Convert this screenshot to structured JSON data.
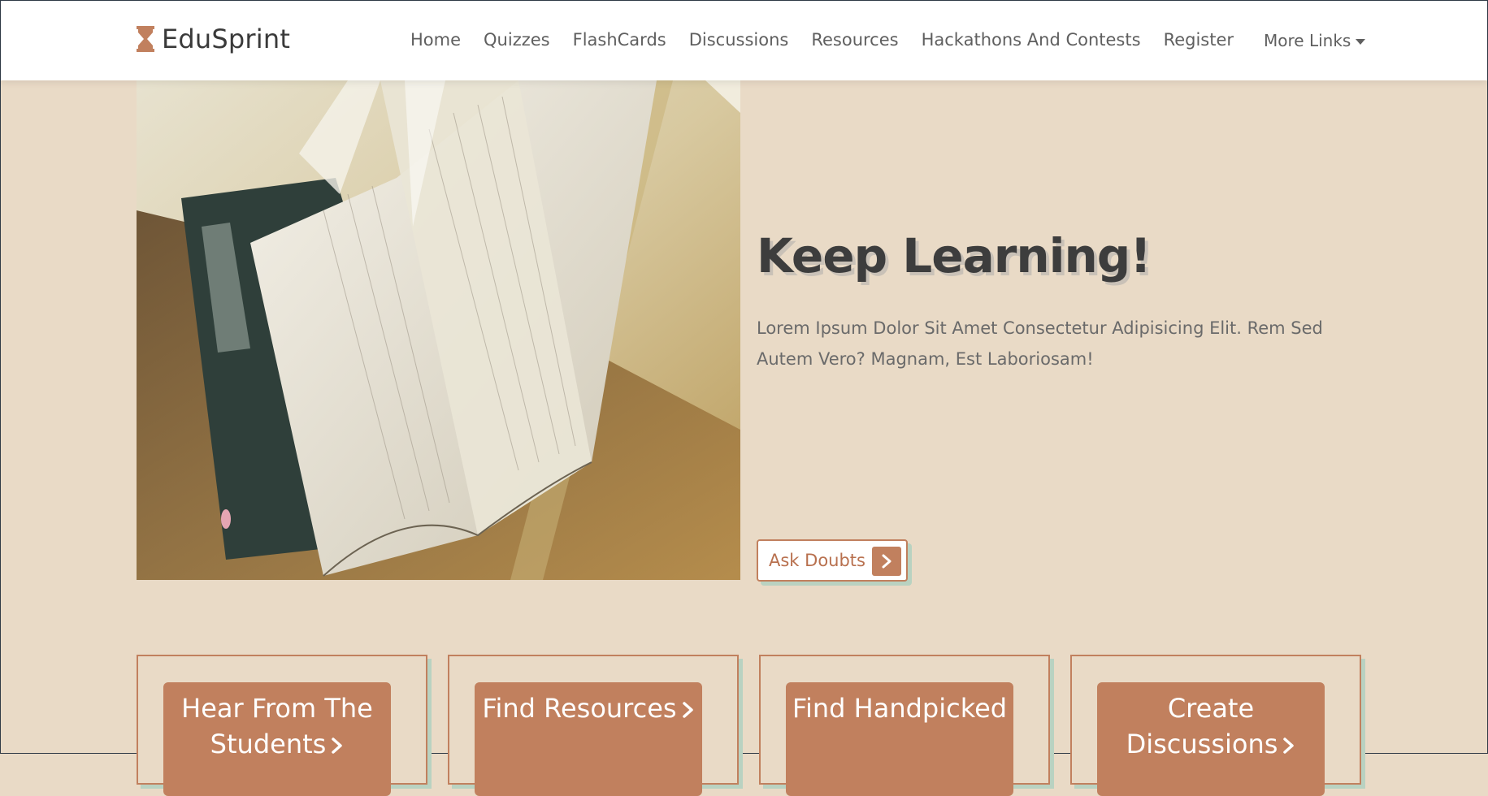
{
  "brand": {
    "name": "EduSprint",
    "icon": "hourglass-icon",
    "accent": "#c1805e"
  },
  "nav": {
    "links": [
      "Home",
      "Quizzes",
      "FlashCards",
      "Discussions",
      "Resources",
      "Hackathons And Contests",
      "Register"
    ],
    "more_label": "More Links"
  },
  "hero": {
    "title": "Keep Learning!",
    "description": "Lorem Ipsum Dolor Sit Amet Consectetur Adipisicing Elit. Rem Sed Autem Vero? Magnam, Est Laboriosam!",
    "button_label": "Ask Doubts",
    "image": "open-book-image"
  },
  "cards": [
    {
      "label": "Hear From The Students"
    },
    {
      "label": "Find Resources"
    },
    {
      "label": "Find Handpicked"
    },
    {
      "label": "Create Discussions"
    }
  ],
  "colors": {
    "background": "#e9dac6",
    "accent": "#c1805e",
    "shadow": "#b9d2c1",
    "text_dark": "#3d3d3d"
  }
}
